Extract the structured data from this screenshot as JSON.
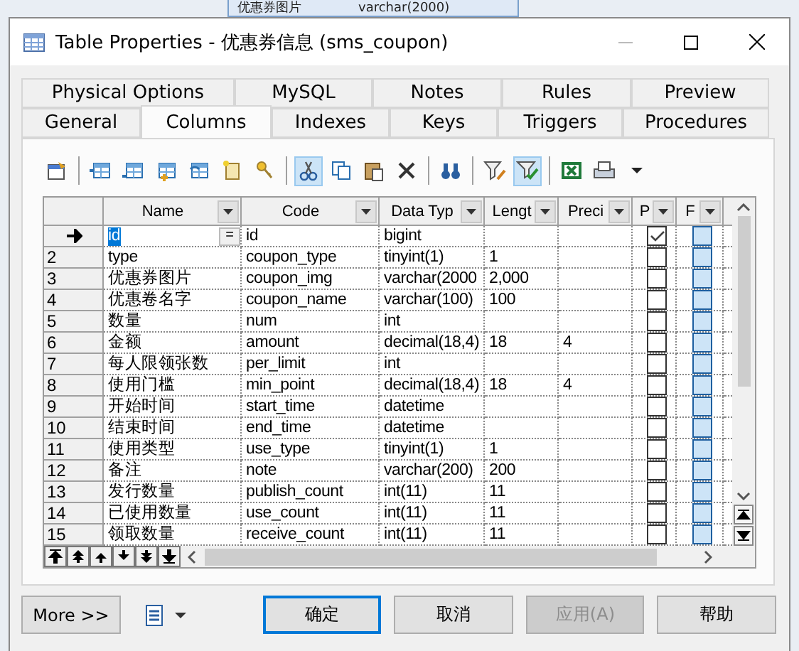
{
  "background": {
    "texts": [
      "优惠券图片",
      "varchar(2000)"
    ]
  },
  "window": {
    "title": "Table Properties - 优惠券信息 (sms_coupon)"
  },
  "tab_rows": [
    [
      {
        "label": "Physical Options",
        "selected": false
      },
      {
        "label": "MySQL",
        "selected": false
      },
      {
        "label": "Notes",
        "selected": false
      },
      {
        "label": "Rules",
        "selected": false
      },
      {
        "label": "Preview",
        "selected": false
      }
    ],
    [
      {
        "label": "General",
        "selected": false
      },
      {
        "label": "Columns",
        "selected": true
      },
      {
        "label": "Indexes",
        "selected": false
      },
      {
        "label": "Keys",
        "selected": false
      },
      {
        "label": "Triggers",
        "selected": false
      },
      {
        "label": "Procedures",
        "selected": false
      }
    ]
  ],
  "grid": {
    "columns": [
      "Name",
      "Code",
      "Data Typ",
      "Lengt",
      "Preci",
      "P",
      "F"
    ],
    "edit_button": "=",
    "rows": [
      {
        "number": "",
        "current": true,
        "name": "id",
        "code": "id",
        "data_type": "bigint",
        "length": "",
        "precision": "",
        "primary": true,
        "foreign": false
      },
      {
        "number": "2",
        "current": false,
        "name": "type",
        "code": "coupon_type",
        "data_type": "tinyint(1)",
        "length": "1",
        "precision": "",
        "primary": false,
        "foreign": false
      },
      {
        "number": "3",
        "current": false,
        "name": "优惠券图片",
        "code": "coupon_img",
        "data_type": "varchar(2000",
        "length": "2,000",
        "precision": "",
        "primary": false,
        "foreign": false
      },
      {
        "number": "4",
        "current": false,
        "name": "优惠卷名字",
        "code": "coupon_name",
        "data_type": "varchar(100)",
        "length": "100",
        "precision": "",
        "primary": false,
        "foreign": false
      },
      {
        "number": "5",
        "current": false,
        "name": "数量",
        "code": "num",
        "data_type": "int",
        "length": "",
        "precision": "",
        "primary": false,
        "foreign": false
      },
      {
        "number": "6",
        "current": false,
        "name": "金额",
        "code": "amount",
        "data_type": "decimal(18,4)",
        "length": "18",
        "precision": "4",
        "primary": false,
        "foreign": false
      },
      {
        "number": "7",
        "current": false,
        "name": "每人限领张数",
        "code": "per_limit",
        "data_type": "int",
        "length": "",
        "precision": "",
        "primary": false,
        "foreign": false
      },
      {
        "number": "8",
        "current": false,
        "name": "使用门槛",
        "code": "min_point",
        "data_type": "decimal(18,4)",
        "length": "18",
        "precision": "4",
        "primary": false,
        "foreign": false
      },
      {
        "number": "9",
        "current": false,
        "name": "开始时间",
        "code": "start_time",
        "data_type": "datetime",
        "length": "",
        "precision": "",
        "primary": false,
        "foreign": false
      },
      {
        "number": "10",
        "current": false,
        "name": "结束时间",
        "code": "end_time",
        "data_type": "datetime",
        "length": "",
        "precision": "",
        "primary": false,
        "foreign": false
      },
      {
        "number": "11",
        "current": false,
        "name": "使用类型",
        "code": "use_type",
        "data_type": "tinyint(1)",
        "length": "1",
        "precision": "",
        "primary": false,
        "foreign": false
      },
      {
        "number": "12",
        "current": false,
        "name": "备注",
        "code": "note",
        "data_type": "varchar(200)",
        "length": "200",
        "precision": "",
        "primary": false,
        "foreign": false
      },
      {
        "number": "13",
        "current": false,
        "name": "发行数量",
        "code": "publish_count",
        "data_type": "int(11)",
        "length": "11",
        "precision": "",
        "primary": false,
        "foreign": false
      },
      {
        "number": "14",
        "current": false,
        "name": "已使用数量",
        "code": "use_count",
        "data_type": "int(11)",
        "length": "11",
        "precision": "",
        "primary": false,
        "foreign": false
      },
      {
        "number": "15",
        "current": false,
        "name": "领取数量",
        "code": "receive_count",
        "data_type": "int(11)",
        "length": "11",
        "precision": "",
        "primary": false,
        "foreign": false
      }
    ]
  },
  "more_button": "More >>",
  "buttons": [
    {
      "label": "确定",
      "default": true,
      "disabled": false
    },
    {
      "label": "取消",
      "default": false,
      "disabled": false
    },
    {
      "label": "应用(A)",
      "default": false,
      "disabled": true
    },
    {
      "label": "帮助",
      "default": false,
      "disabled": false
    }
  ]
}
